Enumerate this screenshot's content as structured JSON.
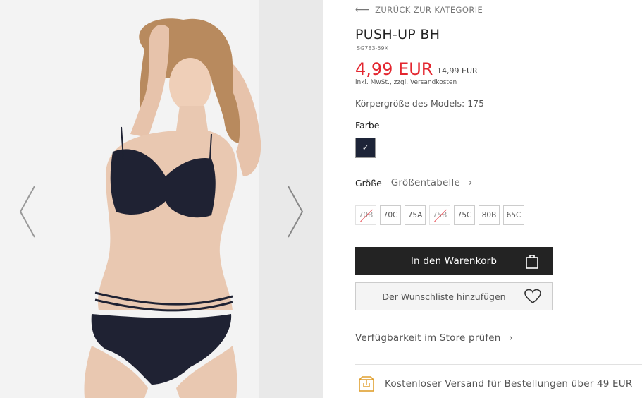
{
  "gallery": {
    "prev_icon": "chevron-left-icon",
    "next_icon": "chevron-right-icon"
  },
  "product": {
    "back_label": "ZURÜCK ZUR KATEGORIE",
    "title": "PUSH-UP BH",
    "sku": "SG783-59X",
    "price": "4,99 EUR",
    "old_price": "14,99 EUR",
    "tax_prefix": "inkl. MwSt.,",
    "tax_link": "zzgl. Versandkosten",
    "model_height": "Körpergröße des Models: 175",
    "color_label": "Farbe",
    "color_swatch": "#1d2438",
    "size_label": "Größe",
    "size_table_link": "Größentabelle",
    "sizes": [
      {
        "label": "70B",
        "available": false
      },
      {
        "label": "70C",
        "available": true
      },
      {
        "label": "75A",
        "available": true
      },
      {
        "label": "75B",
        "available": false
      },
      {
        "label": "75C",
        "available": true
      },
      {
        "label": "80B",
        "available": true
      },
      {
        "label": "65C",
        "available": true
      }
    ],
    "cart_button": "In den Warenkorb",
    "wishlist_button": "Der Wunschliste hinzufügen",
    "availability_link": "Verfügbarkeit im Store prüfen",
    "shipping_note": "Kostenloser Versand für Bestellungen über 49 EUR",
    "accent_color": "#e3262f"
  }
}
